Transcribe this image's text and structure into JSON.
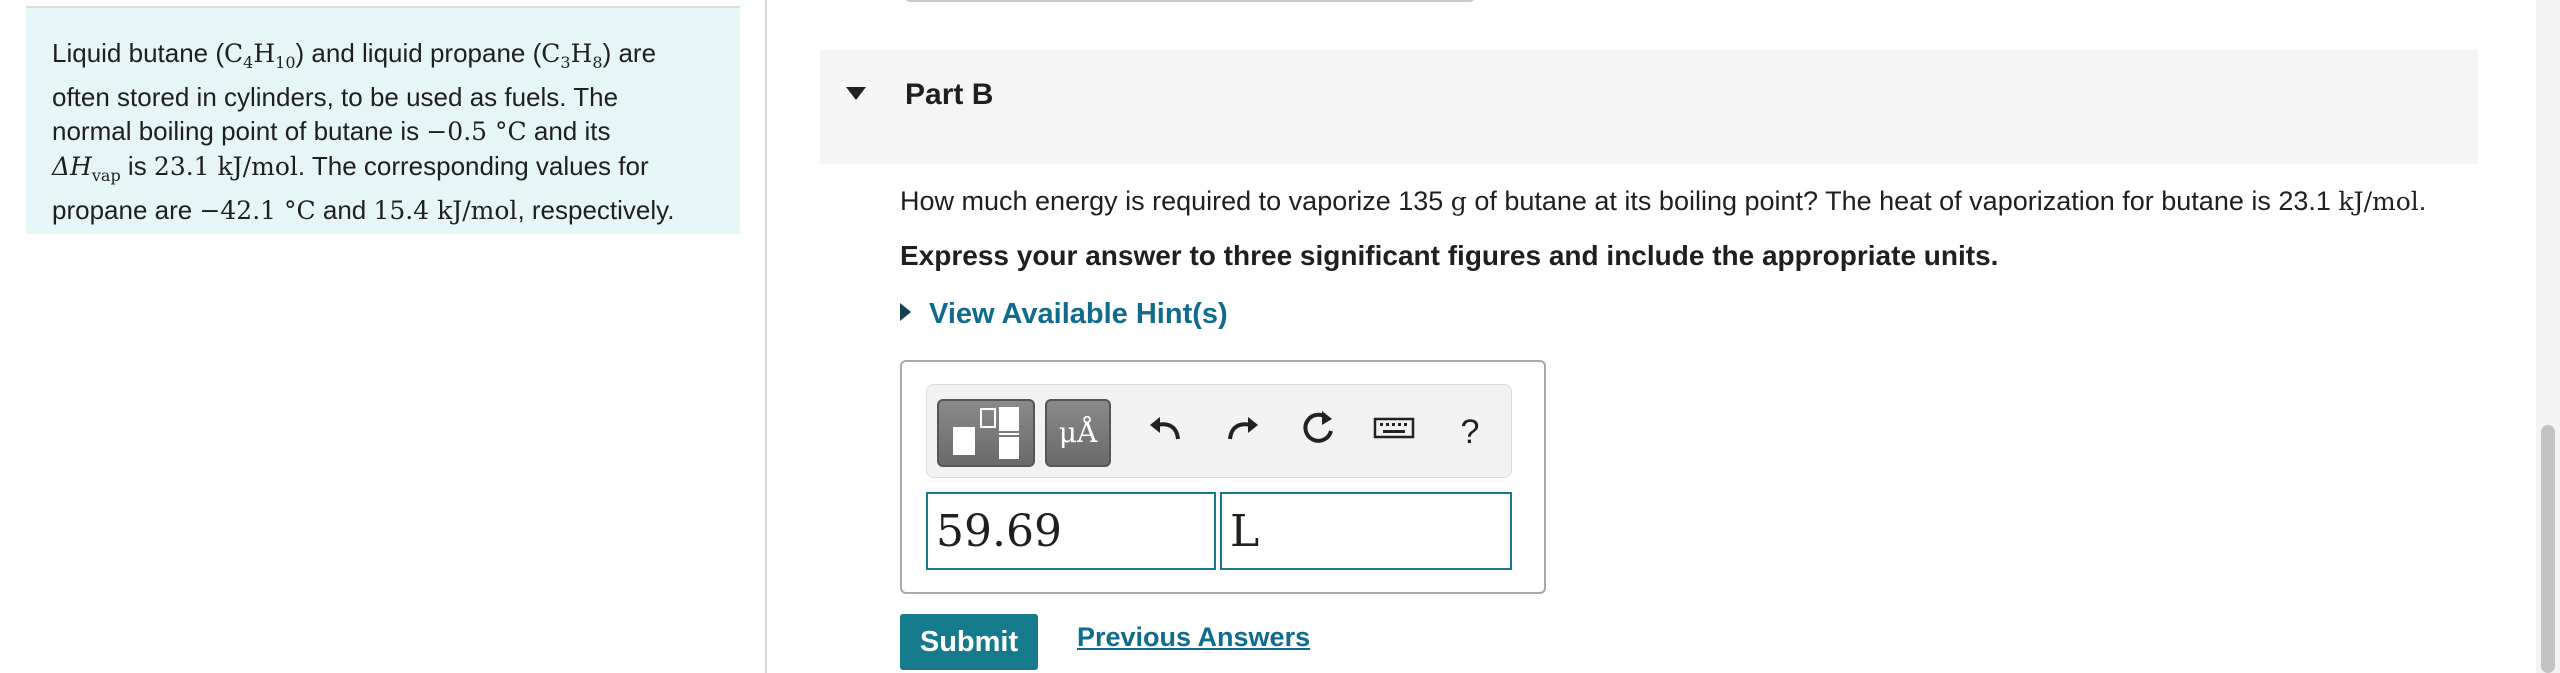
{
  "context": {
    "line1_a": "Liquid butane (",
    "butane_formula": "C",
    "butane_c_sub": "4",
    "butane_h": "H",
    "butane_h_sub": "10",
    "line1_b": ") and liquid propane (",
    "propane_formula": "C",
    "propane_c_sub": "3",
    "propane_h": "H",
    "propane_h_sub": "8",
    "line1_c": ") are",
    "line2": "often stored in cylinders, to be used as fuels. The",
    "line3_a": "normal boiling point of butane is ",
    "butane_bp": "−0.5 °C",
    "line3_b": " and its",
    "dh_symbol": "ΔH",
    "dh_sub": "vap",
    "line4_a": " is ",
    "butane_dh": "23.1 kJ/mol",
    "line4_b": ". The corresponding values for",
    "line5_a": "propane are ",
    "propane_bp": "−42.1 °C",
    "line5_b": " and ",
    "propane_dh": "15.4 kJ/mol",
    "line5_c": ", respectively."
  },
  "part": {
    "title": "Part B"
  },
  "question": {
    "text_a": "How much energy is required to vaporize 135 ",
    "mass_unit": "g",
    "text_b": " of butane at its boiling point? The heat of vaporization for butane is 23.1 ",
    "dh_unit": "kJ/mol",
    "text_c": ".",
    "instruction": "Express your answer to three significant figures and include the appropriate units.",
    "hint_label": "View Available Hint(s)"
  },
  "toolbar": {
    "units_label": "μÅ",
    "help_label": "?",
    "icons": [
      "templates-icon",
      "units-icon",
      "undo-icon",
      "redo-icon",
      "reset-icon",
      "keyboard-icon",
      "help-icon"
    ]
  },
  "answer": {
    "value": "59.69",
    "unit": "L"
  },
  "actions": {
    "submit_label": "Submit",
    "previous_answers_label": "Previous Answers"
  },
  "colors": {
    "accent": "#147a8c",
    "context_bg": "#e6f6f7",
    "header_bg": "#f5f5f5"
  }
}
